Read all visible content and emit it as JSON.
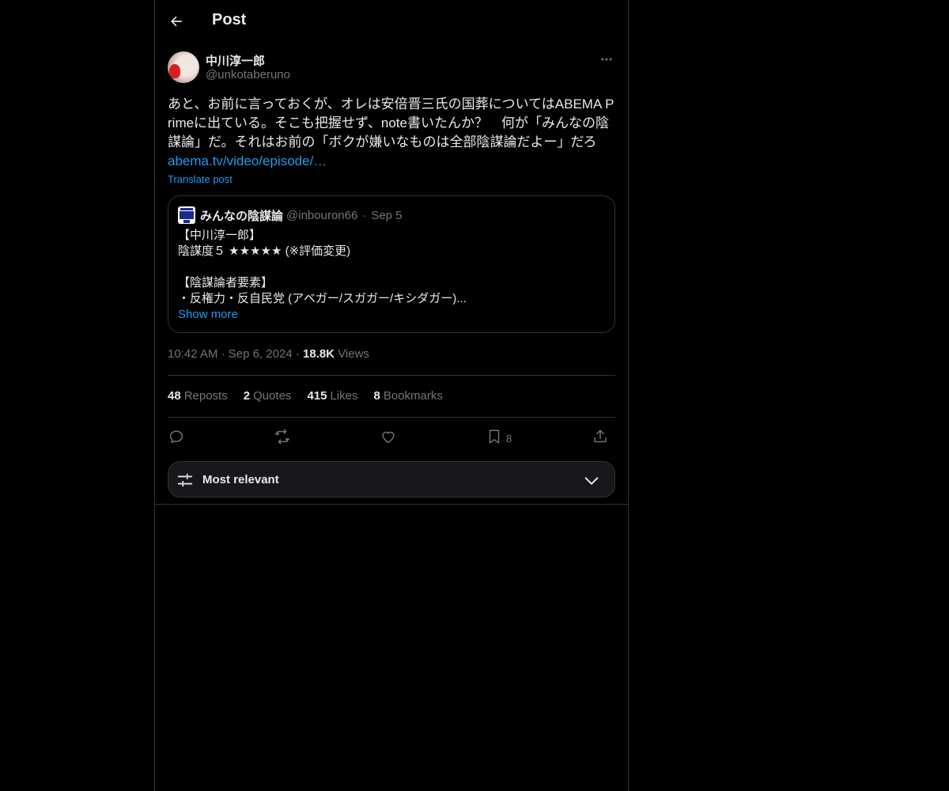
{
  "header": {
    "title": "Post"
  },
  "post": {
    "author_name": "中川淳一郎",
    "author_handle": "@unkotaberuno",
    "text": "あと、お前に言っておくが、オレは安倍晋三氏の国葬についてはABEMA Primeに出ている。そこも把握せず、note書いたんか？　何が「みんなの陰謀論」だ。それはお前の「ボクが嫌いなものは全部陰謀論だよー」だろ",
    "link": "abema.tv/video/episode/…",
    "translate_label": "Translate post",
    "time": "10:42 AM",
    "date": "Sep 6, 2024",
    "views_count": "18.8K",
    "views_label": "Views"
  },
  "quote": {
    "name": "みんなの陰謀論",
    "handle": "@inbouron66",
    "date": "Sep 5",
    "lines": [
      "【中川淳一郎】",
      "陰謀度５ ★★★★★ (※評価変更)",
      "",
      "【陰謀論者要素】",
      "・反権力・反自民党 (アベガー/スガガー/キシダガー)..."
    ],
    "show_more": "Show more"
  },
  "stats": {
    "reposts_count": "48",
    "reposts_label": "Reposts",
    "quotes_count": "2",
    "quotes_label": "Quotes",
    "likes_count": "415",
    "likes_label": "Likes",
    "bookmarks_count": "8",
    "bookmarks_label": "Bookmarks"
  },
  "actions": {
    "bookmark_count": "8"
  },
  "sort": {
    "label": "Most relevant"
  },
  "colors": {
    "background": "#000000",
    "accent": "#1d9bf0",
    "muted": "#71767b",
    "border": "#2f3336"
  }
}
